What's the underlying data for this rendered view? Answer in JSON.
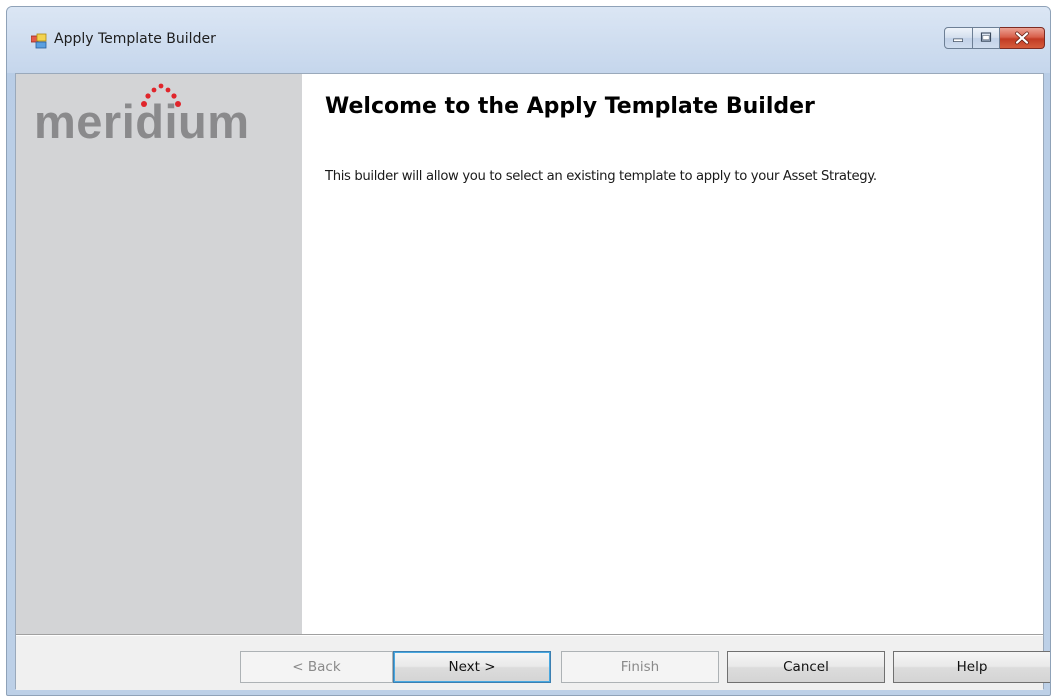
{
  "window": {
    "title": "Apply Template Builder",
    "controls": {
      "minimize_icon": "minimize-icon",
      "maximize_icon": "maximize-icon",
      "close_icon": "close-icon"
    }
  },
  "logo": {
    "text": "meridium",
    "text_color": "#8a8a8c",
    "dot_color": "#e0252b"
  },
  "content": {
    "title": "Welcome to the Apply Template Builder",
    "description": "This builder will allow you to select an existing template to apply to your Asset Strategy."
  },
  "buttons": {
    "back": "< Back",
    "next": "Next >",
    "finish": "Finish",
    "cancel": "Cancel",
    "help": "Help"
  },
  "colors": {
    "side_panel": "#d3d4d6",
    "content_background": "#ffffff",
    "title_bar": "#c5d6ec",
    "close_button": "#c23b24"
  }
}
